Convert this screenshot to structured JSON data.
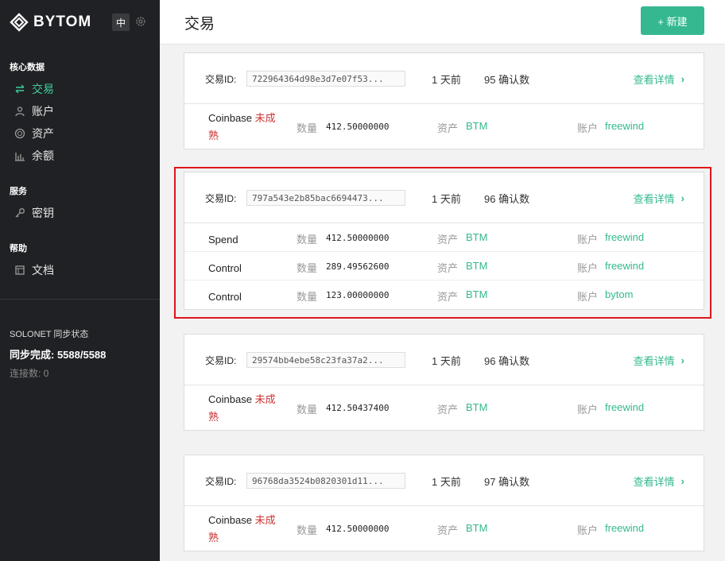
{
  "app": {
    "brand": "BYTOM",
    "lang": "中"
  },
  "sidebar": {
    "sections": [
      {
        "title": "核心数据",
        "items": [
          {
            "label": "交易",
            "icon": "transfer-icon",
            "active": true
          },
          {
            "label": "账户",
            "icon": "user-icon"
          },
          {
            "label": "资产",
            "icon": "asset-icon"
          },
          {
            "label": "余额",
            "icon": "balance-icon"
          }
        ]
      },
      {
        "title": "服务",
        "items": [
          {
            "label": "密钥",
            "icon": "key-icon"
          }
        ]
      },
      {
        "title": "帮助",
        "items": [
          {
            "label": "文档",
            "icon": "doc-icon"
          }
        ]
      }
    ],
    "sync": {
      "title": "SOLONET 同步状态",
      "progress": "同步完成: 5588/5588",
      "peers": "连接数: 0"
    }
  },
  "header": {
    "title": "交易",
    "new_button": "+ 新建"
  },
  "labels": {
    "tx_id": "交易ID:",
    "detail": "查看详情",
    "qty": "数量",
    "asset": "资产",
    "account": "账户",
    "immature": "未成熟"
  },
  "transactions": [
    {
      "id": "722964364d98e3d7e07f53...",
      "time": "1 天前",
      "confirmations": "95 确认数",
      "rows": [
        {
          "type": "Coinbase",
          "immature": true,
          "amount": "412.50000000",
          "asset": "BTM",
          "account": "freewind"
        }
      ]
    },
    {
      "id": "797a543e2b85bac6694473...",
      "time": "1 天前",
      "confirmations": "96 确认数",
      "rows": [
        {
          "type": "Spend",
          "amount": "412.50000000",
          "asset": "BTM",
          "account": "freewind"
        },
        {
          "type": "Control",
          "amount": "289.49562600",
          "asset": "BTM",
          "account": "freewind"
        },
        {
          "type": "Control",
          "amount": "123.00000000",
          "asset": "BTM",
          "account": "bytom"
        }
      ]
    },
    {
      "id": "29574bb4ebe58c23fa37a2...",
      "time": "1 天前",
      "confirmations": "96 确认数",
      "rows": [
        {
          "type": "Coinbase",
          "immature": true,
          "amount": "412.50437400",
          "asset": "BTM",
          "account": "freewind"
        }
      ]
    },
    {
      "id": "96768da3524b0820301d11...",
      "time": "1 天前",
      "confirmations": "97 确认数",
      "rows": [
        {
          "type": "Coinbase",
          "immature": true,
          "amount": "412.50000000",
          "asset": "BTM",
          "account": "freewind"
        }
      ]
    }
  ],
  "colors": {
    "accent": "#35b890",
    "sidebar_bg": "#202124",
    "immature": "#cc3333",
    "highlight": "#e0141c"
  }
}
